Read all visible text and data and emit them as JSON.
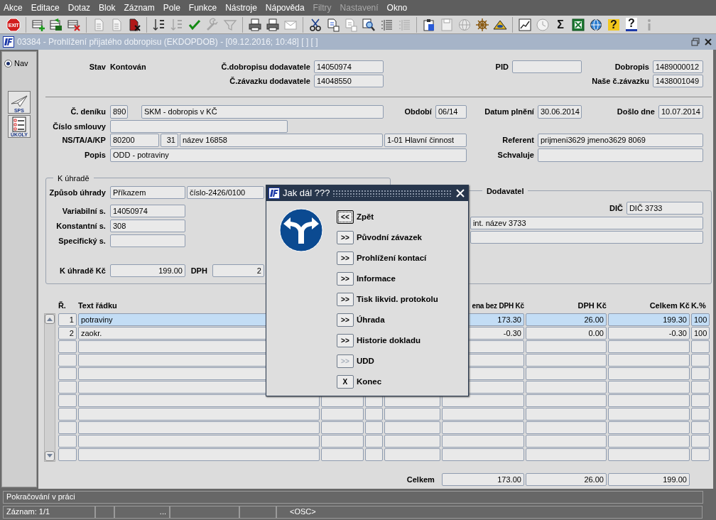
{
  "menu": [
    {
      "label": "Akce",
      "disabled": false
    },
    {
      "label": "Editace",
      "disabled": false
    },
    {
      "label": "Dotaz",
      "disabled": false
    },
    {
      "label": "Blok",
      "disabled": false
    },
    {
      "label": "Záznam",
      "disabled": false
    },
    {
      "label": "Pole",
      "disabled": false
    },
    {
      "label": "Funkce",
      "disabled": false
    },
    {
      "label": "Nástroje",
      "disabled": false
    },
    {
      "label": "Nápověda",
      "disabled": false
    },
    {
      "label": "Filtry",
      "disabled": true
    },
    {
      "label": "Nastavení",
      "disabled": true
    },
    {
      "label": "Okno",
      "disabled": false
    }
  ],
  "toolbar": [
    [
      {
        "label": "EXIT",
        "disabled": false
      }
    ],
    [
      {
        "disabled": false
      },
      {
        "disabled": false
      },
      {
        "disabled": false
      }
    ],
    [
      {
        "disabled": true
      },
      {
        "disabled": true
      },
      {
        "disabled": false
      }
    ],
    [
      {
        "disabled": false
      },
      {
        "disabled": true
      },
      {
        "disabled": false
      },
      {
        "disabled": true
      },
      {
        "disabled": true
      }
    ],
    [
      {
        "disabled": false
      },
      {
        "disabled": false
      },
      {
        "disabled": true
      }
    ],
    [
      {
        "disabled": false
      },
      {
        "disabled": false
      },
      {
        "disabled": true
      },
      {
        "disabled": false
      },
      {
        "disabled": false
      },
      {
        "disabled": true
      }
    ],
    [
      {
        "disabled": false
      },
      {
        "disabled": true
      },
      {
        "disabled": true
      },
      {
        "disabled": false
      },
      {
        "disabled": false
      }
    ],
    [
      {
        "disabled": false
      },
      {
        "disabled": true
      },
      {
        "label": "Σ",
        "disabled": false
      },
      {
        "disabled": false
      },
      {
        "disabled": false
      },
      {
        "label": "?",
        "disabled": false
      },
      {
        "label": "?",
        "disabled": false
      },
      {
        "disabled": true
      }
    ]
  ],
  "window": {
    "title": "03384 - Prohlížení přijatého dobropisu (EKDOPDOB) - [09.12.2016; 10:48] [ ] [ ]"
  },
  "nav": {
    "label": "Nav",
    "selected": true
  },
  "side_buttons": [
    {
      "label": "SPS"
    },
    {
      "label": "ÚKOLY"
    }
  ],
  "record": {
    "status": {
      "label": "Stav",
      "value": "Kontován"
    },
    "supplier_credit_note": {
      "label": "Č.dobropisu dodavatele",
      "value": "14050974"
    },
    "pid": {
      "label": "PID"
    },
    "credit_note": {
      "label": "Dobropis",
      "value": "1489000012"
    },
    "supplier_liability": {
      "label": "Č.závazku dodavatele",
      "value": "14048550"
    },
    "our_liability": {
      "label": "Naše č.závazku",
      "value": "1438001049"
    },
    "journal": {
      "label": "Č. deníku",
      "value": "890",
      "name": "SKM - dobropis v KČ"
    },
    "period": {
      "label": "Období",
      "value": "06/14"
    },
    "performance_date": {
      "label": "Datum plnění",
      "value": "30.06.2014"
    },
    "received_date": {
      "label": "Došlo dne",
      "value": "10.07.2014"
    },
    "contract": {
      "label": "Číslo smlouvy"
    },
    "cost_center": {
      "label": "NS/TA/A/KP",
      "ns": "80200",
      "ta": "31",
      "a": "název 16858",
      "kp": "1-01 Hlavní činnost"
    },
    "referent": {
      "label": "Referent",
      "value": "prijmeni3629 jmeno3629 8069"
    },
    "description": {
      "label": "Popis",
      "value": "ODD - potraviny"
    },
    "approver": {
      "label": "Schvaluje"
    }
  },
  "payment": {
    "title": "K úhradě",
    "method": {
      "label": "Způsob úhrady",
      "value": "Příkazem",
      "account": "číslo-2426/0100"
    },
    "variable_symbol": {
      "label": "Variabilní s.",
      "value": "14050974"
    },
    "constant_symbol": {
      "label": "Konstantní s.",
      "value": "308"
    },
    "specific_symbol": {
      "label": "Specifický s."
    },
    "amount": {
      "label": "K úhradě Kč",
      "value": "199.00"
    },
    "vat": {
      "label": "DPH",
      "value": "2"
    }
  },
  "supplier": {
    "title": "Dodavatel",
    "tax_id": {
      "label": "DIČ",
      "value": "DIČ 3733"
    },
    "name": "int. název 3733"
  },
  "lines": {
    "headers": {
      "row_no": "Ř.",
      "text": "Text řádku",
      "net": "ena bez DPH Kč",
      "vat": "DPH Kč",
      "total": "Celkem Kč",
      "pct": "K.%"
    },
    "rows": [
      {
        "row_no": "1",
        "text": "potraviny",
        "net": "173.30",
        "vat": "26.00",
        "total": "199.30",
        "pct": "100",
        "selected": true
      },
      {
        "row_no": "2",
        "text": "zaokr.",
        "net": "-0.30",
        "vat": "0.00",
        "total": "-0.30",
        "pct": "100",
        "selected": false
      },
      {
        "selected": false
      },
      {
        "selected": false
      },
      {
        "selected": false
      },
      {
        "selected": false
      },
      {
        "selected": false
      },
      {
        "selected": false
      },
      {
        "selected": false
      },
      {
        "selected": false
      },
      {
        "selected": false
      }
    ],
    "totals": {
      "label": "Celkem",
      "net": "173.00",
      "vat": "26.00",
      "total": "199.00"
    }
  },
  "dialog": {
    "title": "Jak dál ???",
    "options": [
      {
        "key": "<<",
        "label": "Zpět",
        "focused": true,
        "disabled": false
      },
      {
        "key": ">>",
        "label": "Původní závazek",
        "focused": false,
        "disabled": false
      },
      {
        "key": ">>",
        "label": "Prohlížení kontací",
        "focused": false,
        "disabled": false
      },
      {
        "key": ">>",
        "label": "Informace",
        "focused": false,
        "disabled": false
      },
      {
        "key": ">>",
        "label": "Tisk likvid. protokolu",
        "focused": false,
        "disabled": false
      },
      {
        "key": ">>",
        "label": "Úhrada",
        "focused": false,
        "disabled": false
      },
      {
        "key": ">>",
        "label": "Historie dokladu",
        "focused": false,
        "disabled": false
      },
      {
        "key": ">>",
        "label": "UDD",
        "focused": false,
        "disabled": true
      },
      {
        "key": "X",
        "label": "Konec",
        "focused": false,
        "disabled": false
      }
    ]
  },
  "status_bar": {
    "message": "Pokračování v práci",
    "record": "Záznam: 1/1",
    "segment_3": "...",
    "mode": "<OSC>"
  }
}
